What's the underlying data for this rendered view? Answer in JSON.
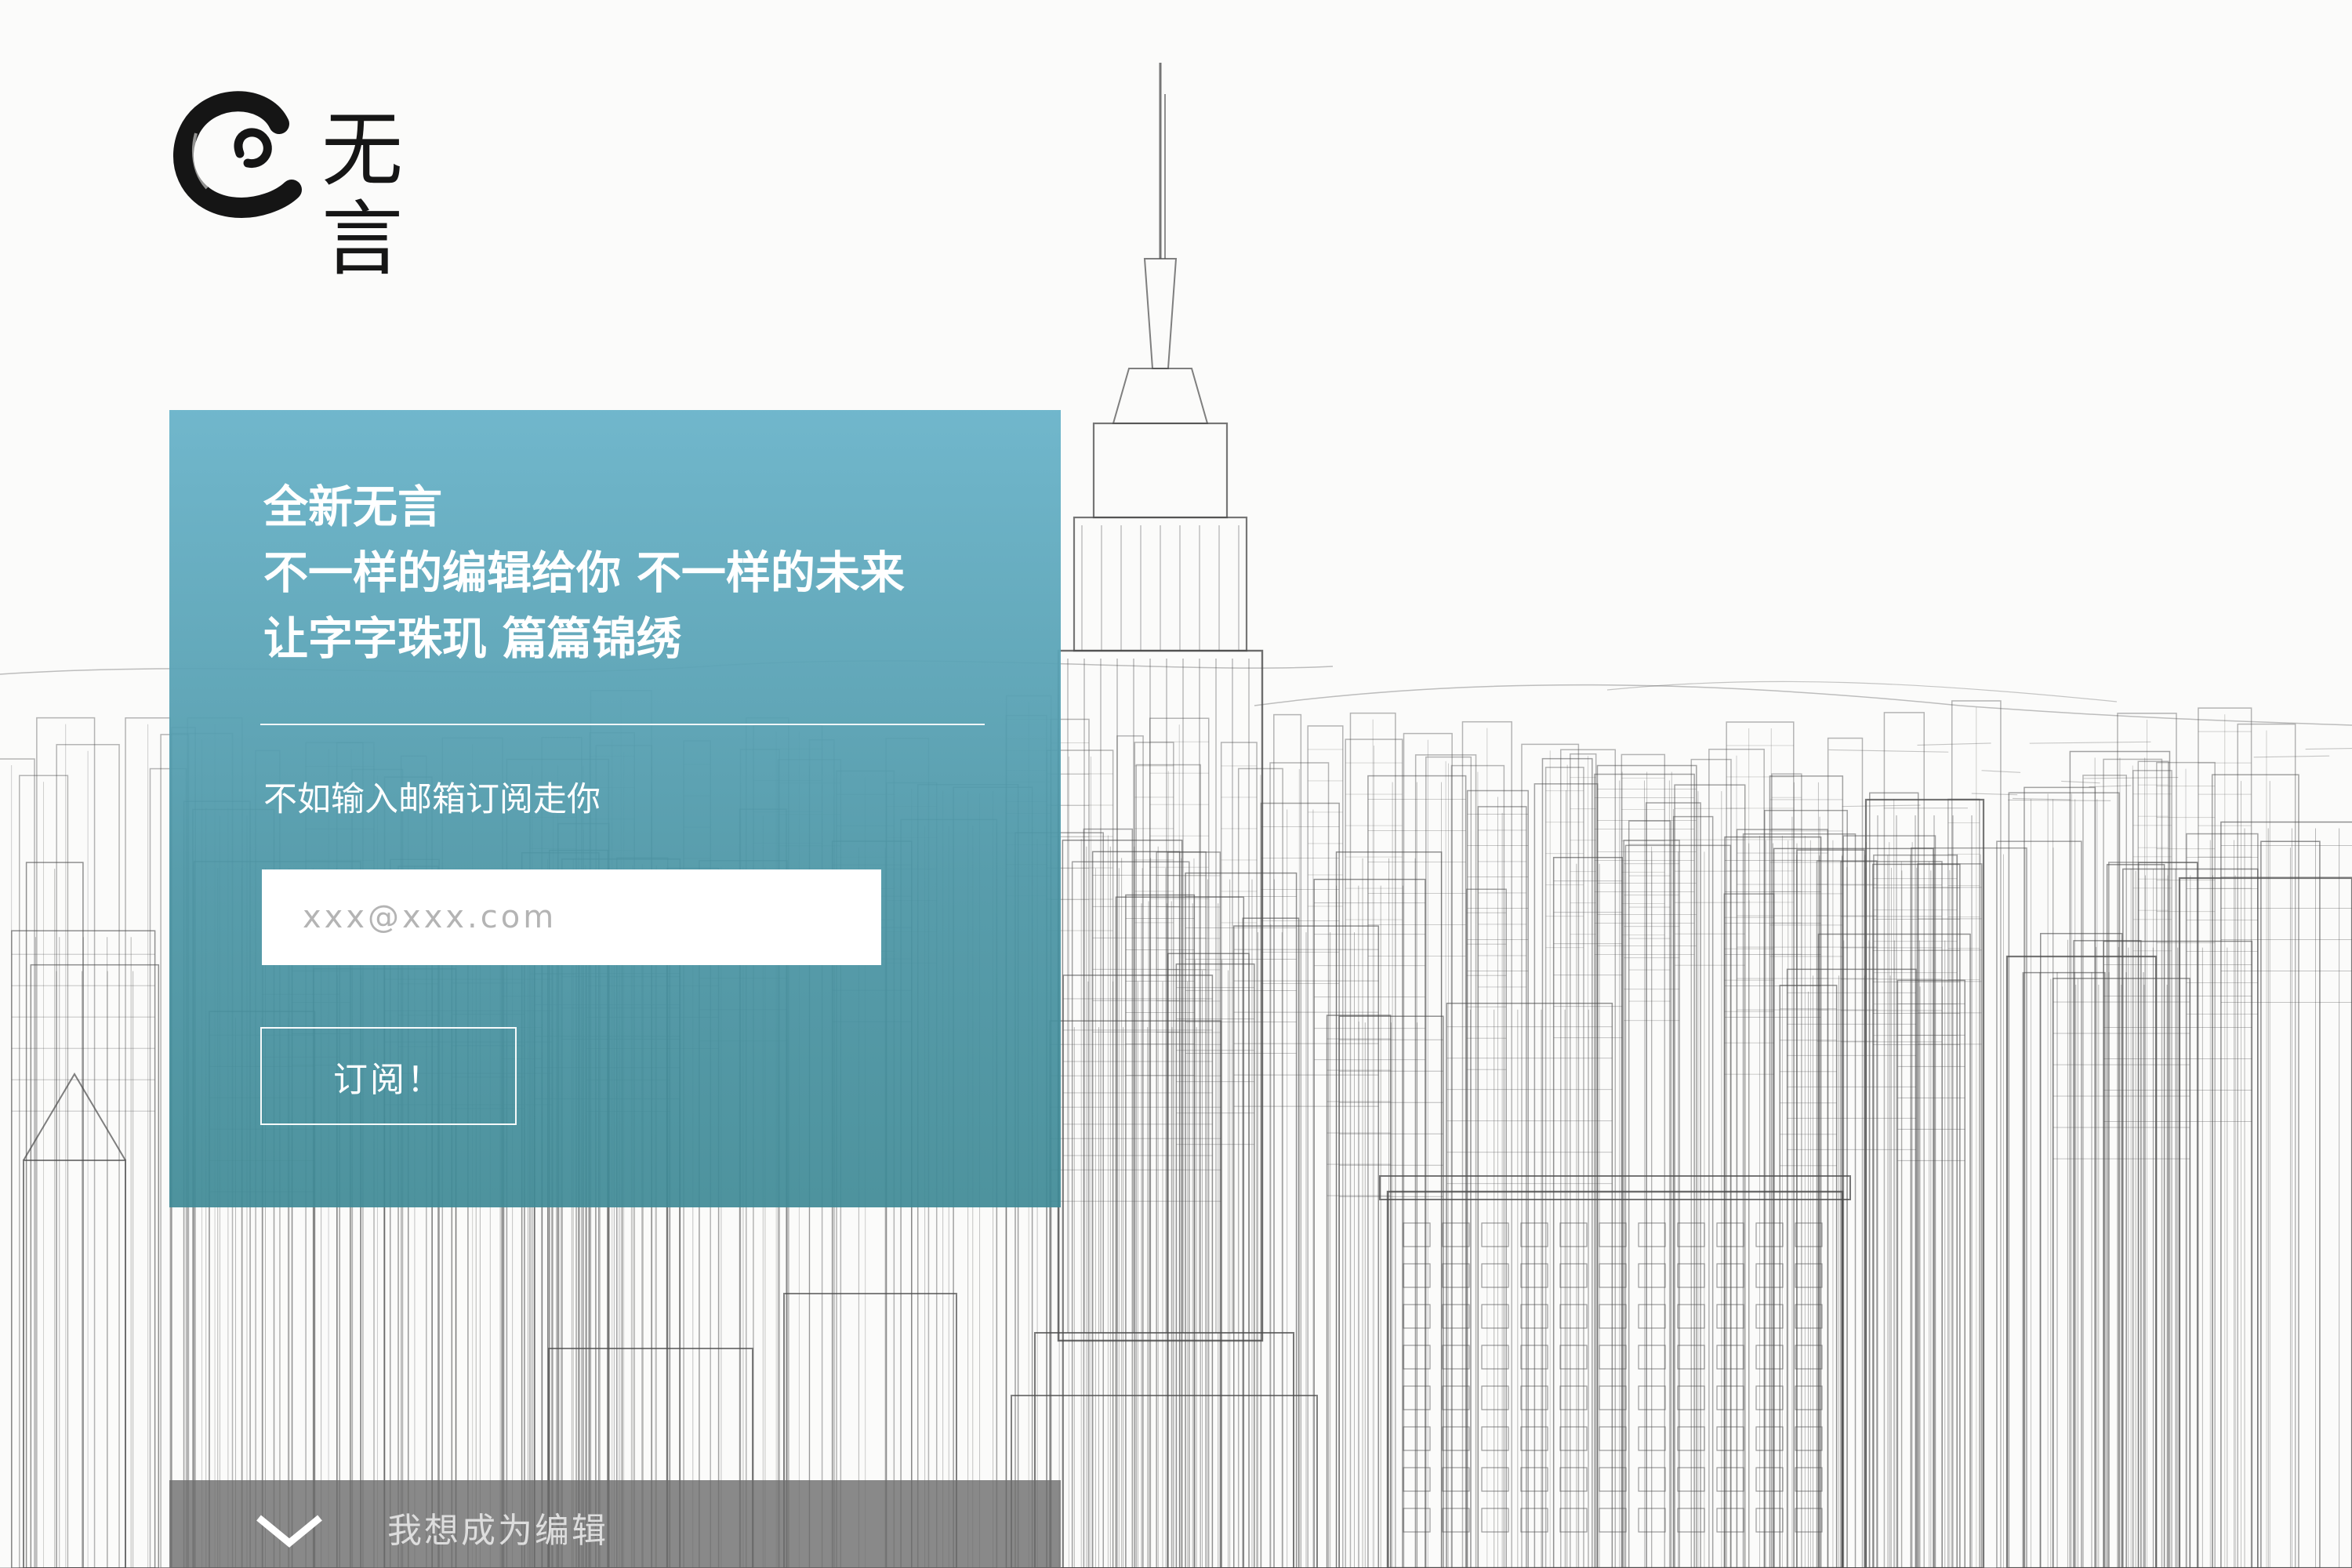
{
  "brand": {
    "name": "无言",
    "logo_icon": "ink-swirl-icon"
  },
  "hero": {
    "headline_lines": [
      "全新无言",
      "不一样的编辑给你 不一样的未来",
      "让字字珠玑 篇篇锦绣"
    ],
    "prompt": "不如输入邮箱订阅走你",
    "email_placeholder": "xxx@xxx.com",
    "subscribe_label": "订阅！"
  },
  "footer": {
    "link_label": "我想成为编辑",
    "icon": "chevron-down-icon"
  },
  "colors": {
    "panel_top": "#6bb4ca",
    "panel_bottom": "#3f8a96",
    "footer_bar": "#696969",
    "sketch_line": "#4a4a4a"
  },
  "background": {
    "icon": "city-skyline-sketch"
  }
}
